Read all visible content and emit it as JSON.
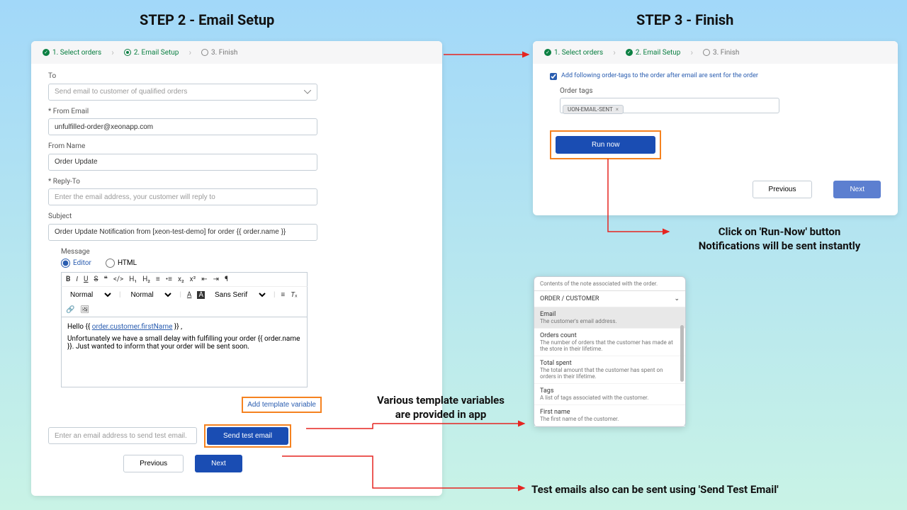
{
  "titles": {
    "step2": "STEP 2 - Email Setup",
    "step3": "STEP 3 - Finish"
  },
  "stepper": {
    "s1": "1. Select orders",
    "s2": "2. Email Setup",
    "s3": "3. Finish"
  },
  "left": {
    "to_label": "To",
    "to_value": "Send email to customer of qualified orders",
    "from_email_label": "* From Email",
    "from_email_value": "unfulfilled-order@xeonapp.com",
    "from_name_label": "From Name",
    "from_name_value": "Order Update",
    "reply_to_label": "* Reply-To",
    "reply_to_placeholder": "Enter the email address, your customer will reply to",
    "subject_label": "Subject",
    "subject_value": "Order Update Notification from [xeon-test-demo] for order {{ order.name }}",
    "message_label": "Message",
    "editor_radio": "Editor",
    "html_radio": "HTML",
    "toolbar": {
      "normal1": "Normal",
      "normal2": "Normal",
      "sans": "Sans Serif"
    },
    "body_hello": "Hello {{ ",
    "body_var": "order.customer.firstName",
    "body_hello_end": " }} ,",
    "body_p2": "Unfortunately we have a small delay with fulfilling your order {{ order.name }}. Just wanted to inform that your order will be sent soon.",
    "add_var": "Add template variable",
    "test_email_placeholder": "Enter an email address to send test email.",
    "send_test": "Send test email",
    "previous": "Previous",
    "next": "Next"
  },
  "right": {
    "checkbox_label": "Add following order-tags to the order after email are sent for the order",
    "order_tags_label": "Order tags",
    "tag_value": "UON-EMAIL-SENT",
    "run_now": "Run now",
    "previous": "Previous",
    "next": "Next"
  },
  "variables": {
    "top_desc": "Contents of the note associated with the order.",
    "section": "ORDER / CUSTOMER",
    "items": [
      {
        "title": "Email",
        "desc": "The customer's email address."
      },
      {
        "title": "Orders count",
        "desc": "The number of orders that the customer has made at the store in their lifetime."
      },
      {
        "title": "Total spent",
        "desc": "The total amount that the customer has spent on orders in their lifetime."
      },
      {
        "title": "Tags",
        "desc": "A list of tags associated with the customer."
      },
      {
        "title": "First name",
        "desc": "The first name of the customer."
      }
    ]
  },
  "annotations": {
    "run_now1": "Click on 'Run-Now' button",
    "run_now2": "Notifications will be sent instantly",
    "vars1": "Various template variables",
    "vars2": "are provided in app",
    "test_email": "Test emails also can be sent using 'Send Test Email'"
  }
}
